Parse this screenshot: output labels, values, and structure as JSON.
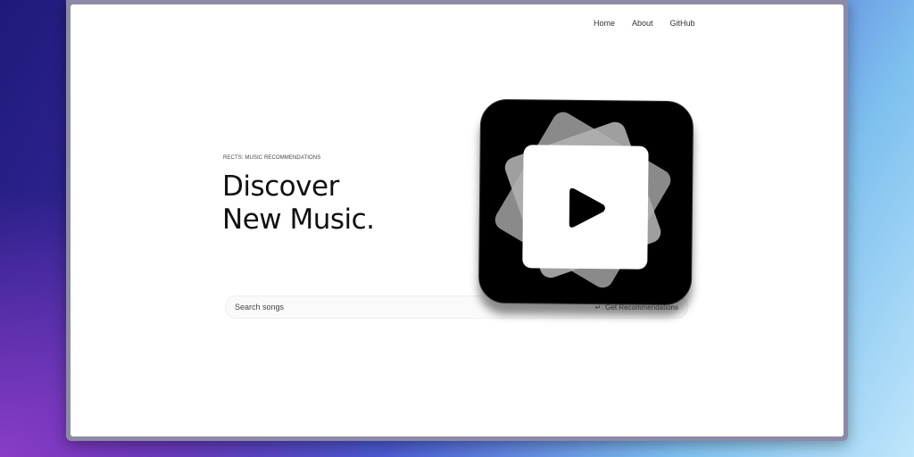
{
  "nav": {
    "items": [
      "Home",
      "About",
      "GitHub"
    ]
  },
  "hero": {
    "eyebrow": "RECTS: MUSIC RECOMMENDATIONS",
    "title_line1": "Discover",
    "title_line2": "New Music."
  },
  "search": {
    "placeholder": "Search songs",
    "value": "",
    "button_label": "Get Recommendations",
    "button_icon": "return-icon"
  },
  "logo": {
    "icon": "play-icon"
  }
}
